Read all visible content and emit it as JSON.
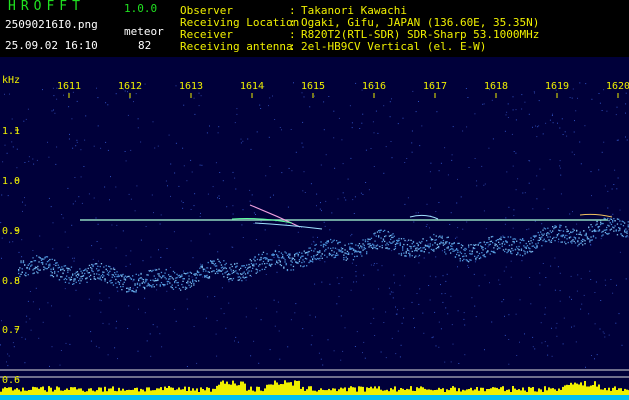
{
  "app": {
    "title": "HROFFT",
    "version": "1.0.0"
  },
  "file_name": "25090216I0.png",
  "detect": {
    "label": "meteor",
    "count": "82"
  },
  "timestamp": "25.09.02 16:10",
  "info": [
    {
      "key": "Observer",
      "sep": ":",
      "value": "Takanori Kawachi"
    },
    {
      "key": "Receiving Location",
      "sep": ":",
      "value": "Ogaki, Gifu, JAPAN (136.60E, 35.35N)"
    },
    {
      "key": "Receiver",
      "sep": ":",
      "value": "R820T2(RTL-SDR) SDR-Sharp 53.1000MHz"
    },
    {
      "key": "Receiving antenna",
      "sep": ":",
      "value": "2el-HB9CV Vertical (el. E-W)"
    }
  ],
  "axes": {
    "y_unit": "kHz",
    "y_ticks": [
      "1.1",
      "1.0",
      "0.9",
      "0.8",
      "0.7",
      "0.6"
    ],
    "x_ticks": [
      "1611",
      "1612",
      "1613",
      "1614",
      "1615",
      "1616",
      "1617",
      "1618",
      "1619",
      "1620"
    ]
  },
  "colors": {
    "background": "#00003a",
    "axis_text": "#f0f000",
    "carrier": "#90d8c0",
    "noise": "#4a8fd8",
    "bars": "#f0f000",
    "baseline": "#00c0f0"
  }
}
